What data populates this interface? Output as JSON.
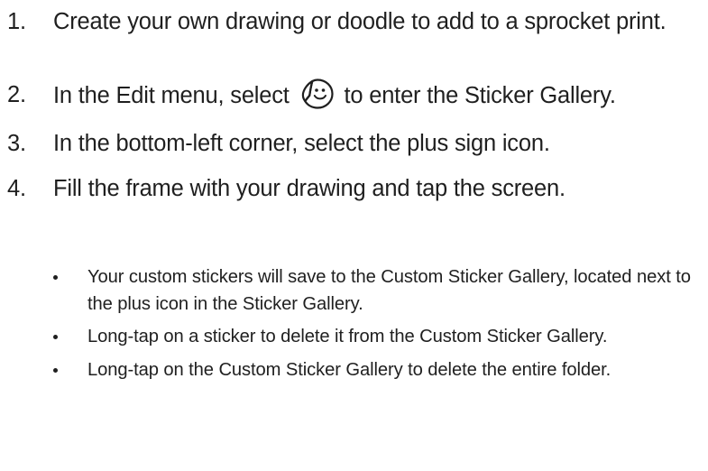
{
  "steps": [
    {
      "number": "1.",
      "text": "Create your own drawing or doodle to add to a sprocket print."
    },
    {
      "number": "2.",
      "text_before": "In the Edit menu, select",
      "icon": "sticker-icon",
      "text_after": "to enter the Sticker Gallery."
    },
    {
      "number": "3.",
      "text": "In the bottom-left corner, select the plus sign icon."
    },
    {
      "number": "4.",
      "text": "Fill the frame with your drawing and tap the screen."
    }
  ],
  "bullets": [
    "Your custom stickers will save to the Custom Sticker Gallery, located next to the plus icon in the Sticker Gallery.",
    "Long-tap on a sticker to delete it from the Custom Sticker Gallery.",
    "Long-tap on the Custom Sticker Gallery to delete the entire folder."
  ]
}
